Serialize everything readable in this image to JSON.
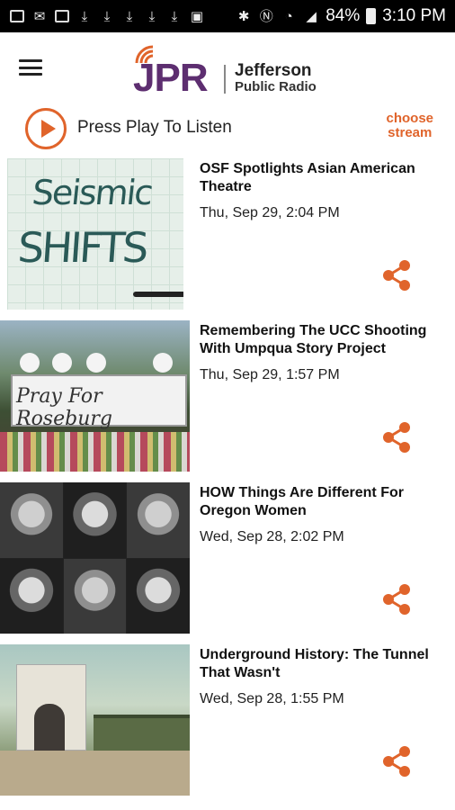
{
  "status_bar": {
    "battery": "84%",
    "time": "3:10 PM",
    "left_icons": [
      "facebook-icon",
      "mail-icon",
      "flipboard-icon",
      "download-icon",
      "download-icon",
      "download-icon",
      "download-icon",
      "download-icon",
      "image-icon"
    ],
    "right_icons": [
      "bluetooth-icon",
      "nfc-icon",
      "wifi-icon",
      "signal-icon",
      "battery-icon"
    ]
  },
  "header": {
    "logo_text": "JPR",
    "logo_name_line1": "Jefferson",
    "logo_name_line2": "Public Radio",
    "brand_purple": "#5d2e70",
    "brand_orange": "#e0642b"
  },
  "player": {
    "label": "Press Play To Listen",
    "stream_line1": "choose",
    "stream_line2": "stream"
  },
  "stories": [
    {
      "title": "OSF Spotlights Asian American Theatre",
      "date": "Thu, Sep 29, 2:04 PM",
      "thumb_text_1": "Seismic",
      "thumb_text_2": "SHIFTS"
    },
    {
      "title": "Remembering The UCC Shooting With Umpqua Story Project",
      "date": "Thu, Sep 29, 1:57 PM",
      "thumb_text_1": "Pray For Roseburg"
    },
    {
      "title": "HOW Things Are Different For Oregon Women",
      "date": "Wed, Sep 28, 2:02 PM"
    },
    {
      "title": "Underground History: The Tunnel That Wasn't",
      "date": "Wed, Sep 28, 1:55 PM"
    }
  ]
}
